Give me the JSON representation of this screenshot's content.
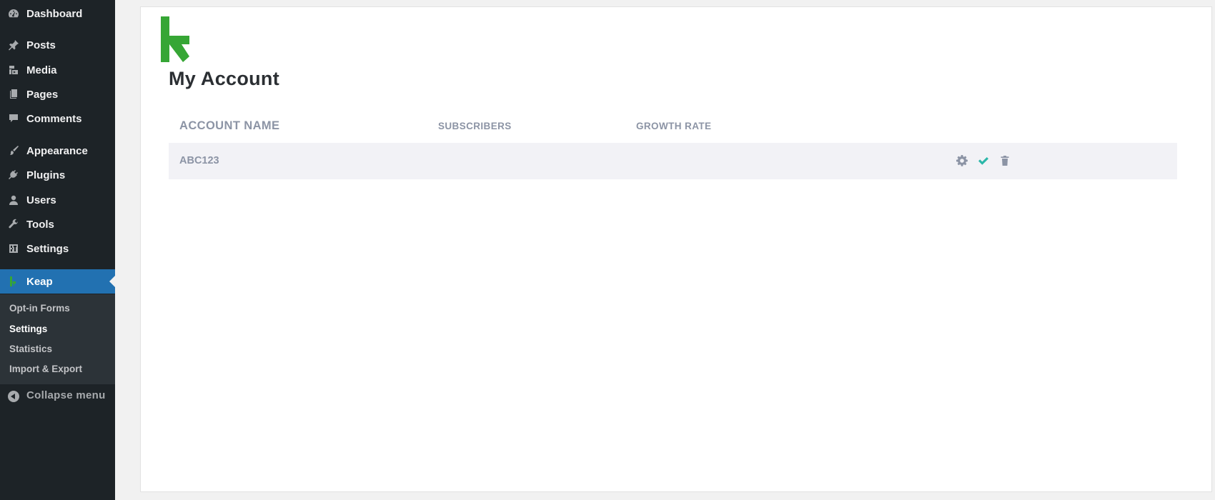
{
  "sidebar": {
    "items": [
      {
        "label": "Dashboard",
        "icon": "dashboard-icon"
      },
      {
        "label": "Posts",
        "icon": "pin-icon"
      },
      {
        "label": "Media",
        "icon": "media-icon"
      },
      {
        "label": "Pages",
        "icon": "pages-icon"
      },
      {
        "label": "Comments",
        "icon": "comment-icon"
      },
      {
        "label": "Appearance",
        "icon": "brush-icon"
      },
      {
        "label": "Plugins",
        "icon": "plugin-icon"
      },
      {
        "label": "Users",
        "icon": "user-icon"
      },
      {
        "label": "Tools",
        "icon": "wrench-icon"
      },
      {
        "label": "Settings",
        "icon": "settings-icon"
      },
      {
        "label": "Keap",
        "icon": "keap-logo-icon",
        "active": true
      }
    ],
    "submenu": [
      {
        "label": "Opt-in Forms"
      },
      {
        "label": "Settings",
        "current": true
      },
      {
        "label": "Statistics"
      },
      {
        "label": "Import & Export"
      }
    ],
    "collapse_label": "Collapse menu"
  },
  "main": {
    "title": "My Account",
    "table": {
      "headers": [
        "ACCOUNT NAME",
        "SUBSCRIBERS",
        "GROWTH RATE"
      ],
      "rows": [
        {
          "account_name": "ABC123",
          "subscribers": "",
          "growth_rate": "",
          "actions": [
            "gear-icon",
            "check-icon",
            "trash-icon"
          ]
        }
      ]
    }
  },
  "colors": {
    "sidebar_bg": "#1d2327",
    "active_bg": "#2271b1",
    "keap_green": "#36a635",
    "check_teal": "#2bb7a9",
    "header_text": "#8c94a5"
  }
}
